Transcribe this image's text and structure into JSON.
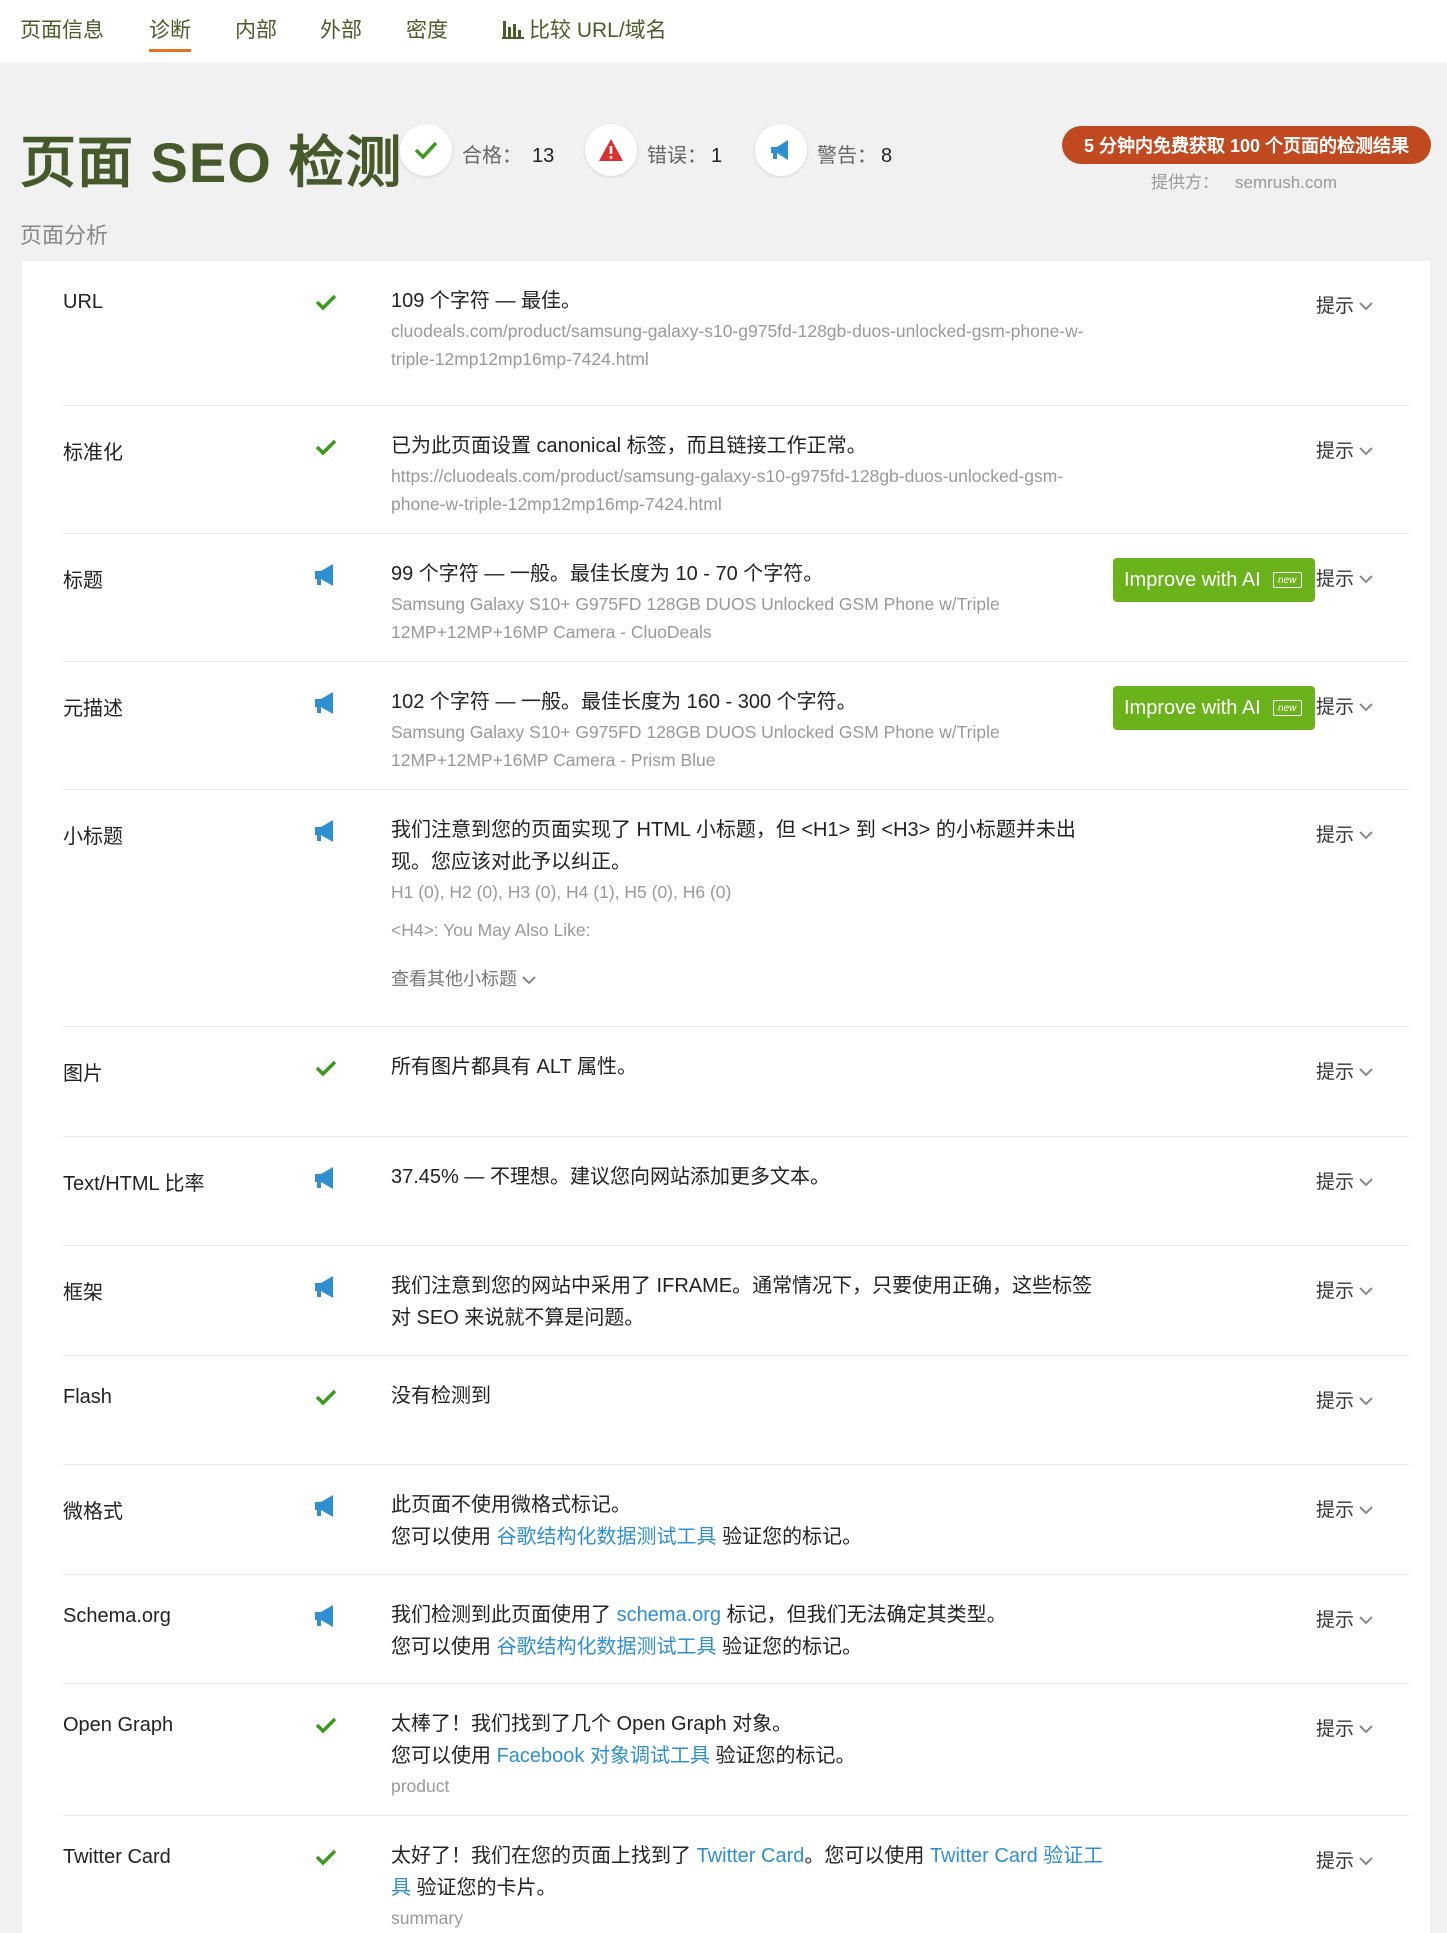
{
  "nav": {
    "tabs": [
      {
        "label": "页面信息"
      },
      {
        "label": "诊断"
      },
      {
        "label": "内部"
      },
      {
        "label": "外部"
      },
      {
        "label": "密度"
      },
      {
        "label": "比较 URL/域名"
      }
    ],
    "active": "诊断",
    "compare_icon": "bar-chart-icon"
  },
  "header": {
    "title": "页面 SEO 检测",
    "pass_label": "合格：",
    "pass_count": "13",
    "error_label": "错误：",
    "error_count": "1",
    "warning_label": "警告：",
    "warning_count": "8",
    "promo": "5 分钟内免费获取 100 个页面的检测结果",
    "provider_label": "提供方：",
    "provider_name": "semrush.com"
  },
  "section_label": "页面分析",
  "colors": {
    "title_green": "#46592a",
    "pass_green": "#3c9b1e",
    "warn_blue": "#2f8fd0",
    "error_red": "#dd2f2f",
    "promo": "#c0491f",
    "ai_button": "#6bb31b",
    "link": "#2f8fd0"
  },
  "hint_label": "提示",
  "ai_button": {
    "label": "Improve with AI",
    "badge": "new"
  },
  "rows": [
    {
      "name": "URL",
      "status": "pass",
      "main": "109 个字符 — 最佳。",
      "sub": "cluodeals.com/product/samsung-galaxy-s10-g975fd-128gb-duos-unlocked-gsm-phone-w-triple-12mp12mp16mp-7424.html"
    },
    {
      "name": "标准化",
      "status": "pass",
      "main": "已为此页面设置 canonical 标签，而且链接工作正常。",
      "sub": "https://cluodeals.com/product/samsung-galaxy-s10-g975fd-128gb-duos-unlocked-gsm-phone-w-triple-12mp12mp16mp-7424.html"
    },
    {
      "name": "标题",
      "status": "warning",
      "main": "99 个字符 — 一般。最佳长度为 10 - 70 个字符。",
      "sub": "Samsung Galaxy S10+ G975FD 128GB DUOS Unlocked GSM Phone w/Triple 12MP+12MP+16MP Camera - CluoDeals"
    },
    {
      "name": "元描述",
      "status": "warning",
      "main": "102 个字符 — 一般。最佳长度为 160 - 300 个字符。",
      "sub": "Samsung Galaxy S10+ G975FD 128GB DUOS Unlocked GSM Phone w/Triple 12MP+12MP+16MP Camera - Prism Blue"
    },
    {
      "name": "小标题",
      "status": "warning",
      "main": "我们注意到您的页面实现了 HTML 小标题，但 <H1> 到 <H3> 的小标题并未出现。您应该对此予以纠正。",
      "sub": "H1 (0), H2 (0), H3 (0), H4 (1), H5 (0), H6 (0)",
      "extra": "<H4>: You May Also Like:",
      "more": "查看其他小标题"
    },
    {
      "name": "图片",
      "status": "pass",
      "main": "所有图片都具有 ALT 属性。"
    },
    {
      "name": "Text/HTML 比率",
      "status": "warning",
      "main": "37.45% — 不理想。建议您向网站添加更多文本。"
    },
    {
      "name": "框架",
      "status": "warning",
      "main": "我们注意到您的网站中采用了 IFRAME。通常情况下，只要使用正确，这些标签对 SEO 来说就不算是问题。"
    },
    {
      "name": "Flash",
      "status": "pass",
      "main": "没有检测到"
    },
    {
      "name": "微格式",
      "status": "warning",
      "main": "此页面不使用微格式标记。",
      "line2_pre": "您可以使用 ",
      "line2_link": "谷歌结构化数据测试工具",
      "line2_post": " 验证您的标记。"
    },
    {
      "name": "Schema.org",
      "status": "warning",
      "main_pre": "我们检测到此页面使用了 ",
      "main_link": "schema.org",
      "main_post": " 标记，但我们无法确定其类型。",
      "line2_pre": "您可以使用 ",
      "line2_link": "谷歌结构化数据测试工具",
      "line2_post": " 验证您的标记。"
    },
    {
      "name": "Open Graph",
      "status": "pass",
      "main": "太棒了！我们找到了几个 Open Graph 对象。",
      "line2_pre": "您可以使用 ",
      "line2_link": "Facebook 对象调试工具",
      "line2_post": " 验证您的标记。",
      "sub": "product"
    },
    {
      "name": "Twitter Card",
      "status": "pass",
      "main_pre": "太好了！我们在您的页面上找到了 ",
      "main_link": "Twitter Card",
      "main_mid": "。您可以使用 ",
      "main_link2": "Twitter Card 验证工具",
      "main_post": " 验证您的卡片。",
      "sub": "summary"
    }
  ]
}
